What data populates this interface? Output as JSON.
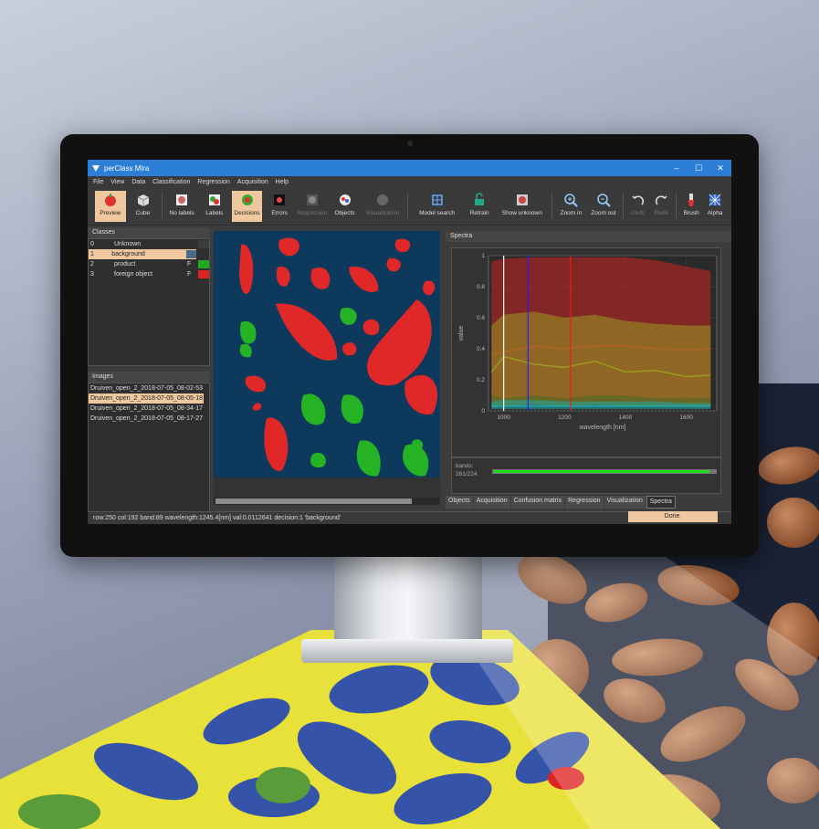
{
  "window": {
    "title": "perClass Mira",
    "controls": [
      "–",
      "☐",
      "✕"
    ]
  },
  "menu": [
    "File",
    "View",
    "Data",
    "Classification",
    "Regression",
    "Acquisition",
    "Help"
  ],
  "toolbar": [
    {
      "label": "Preview",
      "icon": "preview-icon",
      "active": true
    },
    {
      "label": "Cube",
      "icon": "cube-icon"
    },
    {
      "label": "No labels",
      "icon": "no-labels-icon"
    },
    {
      "label": "Labels",
      "icon": "labels-icon"
    },
    {
      "label": "Decisions",
      "icon": "decisions-icon",
      "active": true
    },
    {
      "label": "Errors",
      "icon": "errors-icon"
    },
    {
      "label": "Regression",
      "icon": "regression-icon",
      "disabled": true
    },
    {
      "label": "Objects",
      "icon": "objects-icon"
    },
    {
      "label": "Visualization",
      "icon": "visualization-icon",
      "disabled": true
    },
    {
      "label": "Model search",
      "icon": "model-search-icon"
    },
    {
      "label": "Retrain",
      "icon": "retrain-icon"
    },
    {
      "label": "Show unknown",
      "icon": "show-unknown-icon"
    },
    {
      "label": "Zoom in",
      "icon": "zoom-in-icon"
    },
    {
      "label": "Zoom out",
      "icon": "zoom-out-icon"
    },
    {
      "label": "Undo",
      "icon": "undo-icon",
      "disabled": true
    },
    {
      "label": "Redo",
      "icon": "redo-icon",
      "disabled": true
    },
    {
      "label": "Brush",
      "icon": "brush-icon"
    },
    {
      "label": "Alpha",
      "icon": "alpha-icon"
    }
  ],
  "classes_panel": {
    "title": "Classes",
    "rows": [
      {
        "idx": "0",
        "name": "Unknown",
        "flag": "",
        "color": "#3c3c3c"
      },
      {
        "idx": "1",
        "name": "background",
        "flag": "",
        "color": "#4a6a8a",
        "selected": true
      },
      {
        "idx": "2",
        "name": "product",
        "flag": "F",
        "color": "#22aa22"
      },
      {
        "idx": "3",
        "name": "foreign object",
        "flag": "F",
        "color": "#dd2222"
      }
    ]
  },
  "images_panel": {
    "title": "Images",
    "rows": [
      {
        "name": "Druiven_open_2_2018-07-05_08-02-53"
      },
      {
        "name": "Druiven_open_2_2018-07-05_08-05-18",
        "selected": true
      },
      {
        "name": "Druiven_open_2_2018-07-05_08-34-17"
      },
      {
        "name": "Druiven_open_2_2018-07-05_08-17-27"
      }
    ]
  },
  "spectra_panel": {
    "title": "Spectra",
    "bands_label": "bands:",
    "bands_value": "281/224",
    "tabs": [
      "Objects",
      "Acquisition",
      "Confusion matrix",
      "Regression",
      "Visualization",
      "Spectra"
    ],
    "active_tab": "Spectra"
  },
  "chart_data": {
    "type": "area",
    "xlabel": "wavelength [nm]",
    "ylabel": "value",
    "xlim": [
      950,
      1700
    ],
    "ylim": [
      0,
      1
    ],
    "xticks": [
      1000,
      1200,
      1400,
      1600
    ],
    "yticks": [
      0,
      0.2,
      0.4,
      0.6,
      0.8,
      1
    ],
    "series": [
      {
        "color": "#cc2222",
        "x": [
          960,
          1000,
          1100,
          1200,
          1300,
          1400,
          1500,
          1600,
          1680
        ],
        "upper": [
          0.96,
          0.98,
          0.99,
          0.99,
          0.99,
          0.99,
          0.97,
          0.93,
          0.9
        ],
        "lower": [
          0.1,
          0.08,
          0.1,
          0.08,
          0.1,
          0.1,
          0.08,
          0.08,
          0.08
        ],
        "mean": [
          0.36,
          0.38,
          0.42,
          0.4,
          0.42,
          0.42,
          0.4,
          0.39,
          0.4
        ]
      },
      {
        "color": "#9a9a22",
        "x": [
          960,
          1000,
          1100,
          1200,
          1300,
          1400,
          1500,
          1600,
          1680
        ],
        "upper": [
          0.55,
          0.62,
          0.64,
          0.6,
          0.62,
          0.58,
          0.56,
          0.55,
          0.55
        ],
        "lower": [
          0.02,
          0.03,
          0.04,
          0.03,
          0.04,
          0.03,
          0.03,
          0.03,
          0.03
        ],
        "mean": [
          0.25,
          0.35,
          0.3,
          0.28,
          0.32,
          0.25,
          0.26,
          0.22,
          0.23
        ]
      },
      {
        "color": "#22aaaa",
        "x": [
          960,
          1000,
          1100,
          1200,
          1300,
          1400,
          1500,
          1600,
          1680
        ],
        "upper": [
          0.06,
          0.07,
          0.07,
          0.06,
          0.06,
          0.06,
          0.06,
          0.05,
          0.05
        ],
        "lower": [
          0.01,
          0.01,
          0.01,
          0.01,
          0.01,
          0.01,
          0.01,
          0.01,
          0.01
        ],
        "mean": [
          0.03,
          0.03,
          0.03,
          0.03,
          0.03,
          0.03,
          0.03,
          0.03,
          0.03
        ]
      }
    ],
    "markers": [
      {
        "x": 1000,
        "color": "#ffffff"
      },
      {
        "x": 1080,
        "color": "#2222ff"
      },
      {
        "x": 1220,
        "color": "#dd2222"
      }
    ]
  },
  "status": {
    "text": "row:250 col:192 band:89 wavelength:1245.4[nm] val:0.0112641 decision:1 'background'",
    "done_label": "Done."
  }
}
